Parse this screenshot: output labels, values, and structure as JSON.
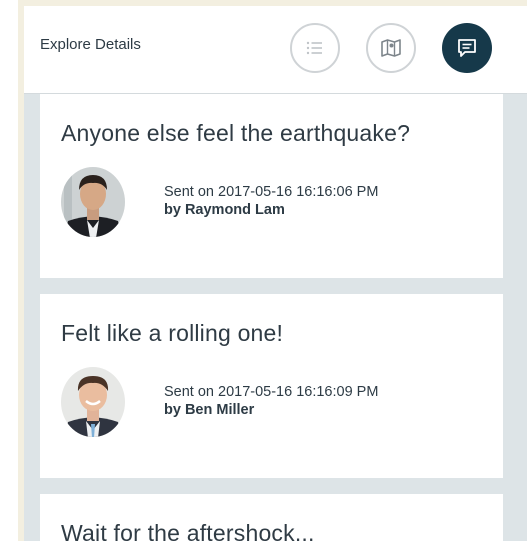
{
  "header": {
    "title": "Explore Details",
    "buttons": [
      {
        "icon": "list-icon",
        "active": false
      },
      {
        "icon": "map-icon",
        "active": false
      },
      {
        "icon": "message-icon",
        "active": true
      }
    ],
    "colors": {
      "active": "#16394a",
      "outline": "#cfd3d6"
    }
  },
  "messages": [
    {
      "text": "Anyone else feel the earthquake?",
      "sent": "Sent on 2017-05-16 16:16:06 PM",
      "by": "by Raymond Lam",
      "avatar": "user-avatar"
    },
    {
      "text": "Felt like a rolling one!",
      "sent": "Sent on 2017-05-16 16:16:09 PM",
      "by": "by Ben Miller",
      "avatar": "user-avatar"
    },
    {
      "text": "Wait for the aftershock..."
    }
  ]
}
